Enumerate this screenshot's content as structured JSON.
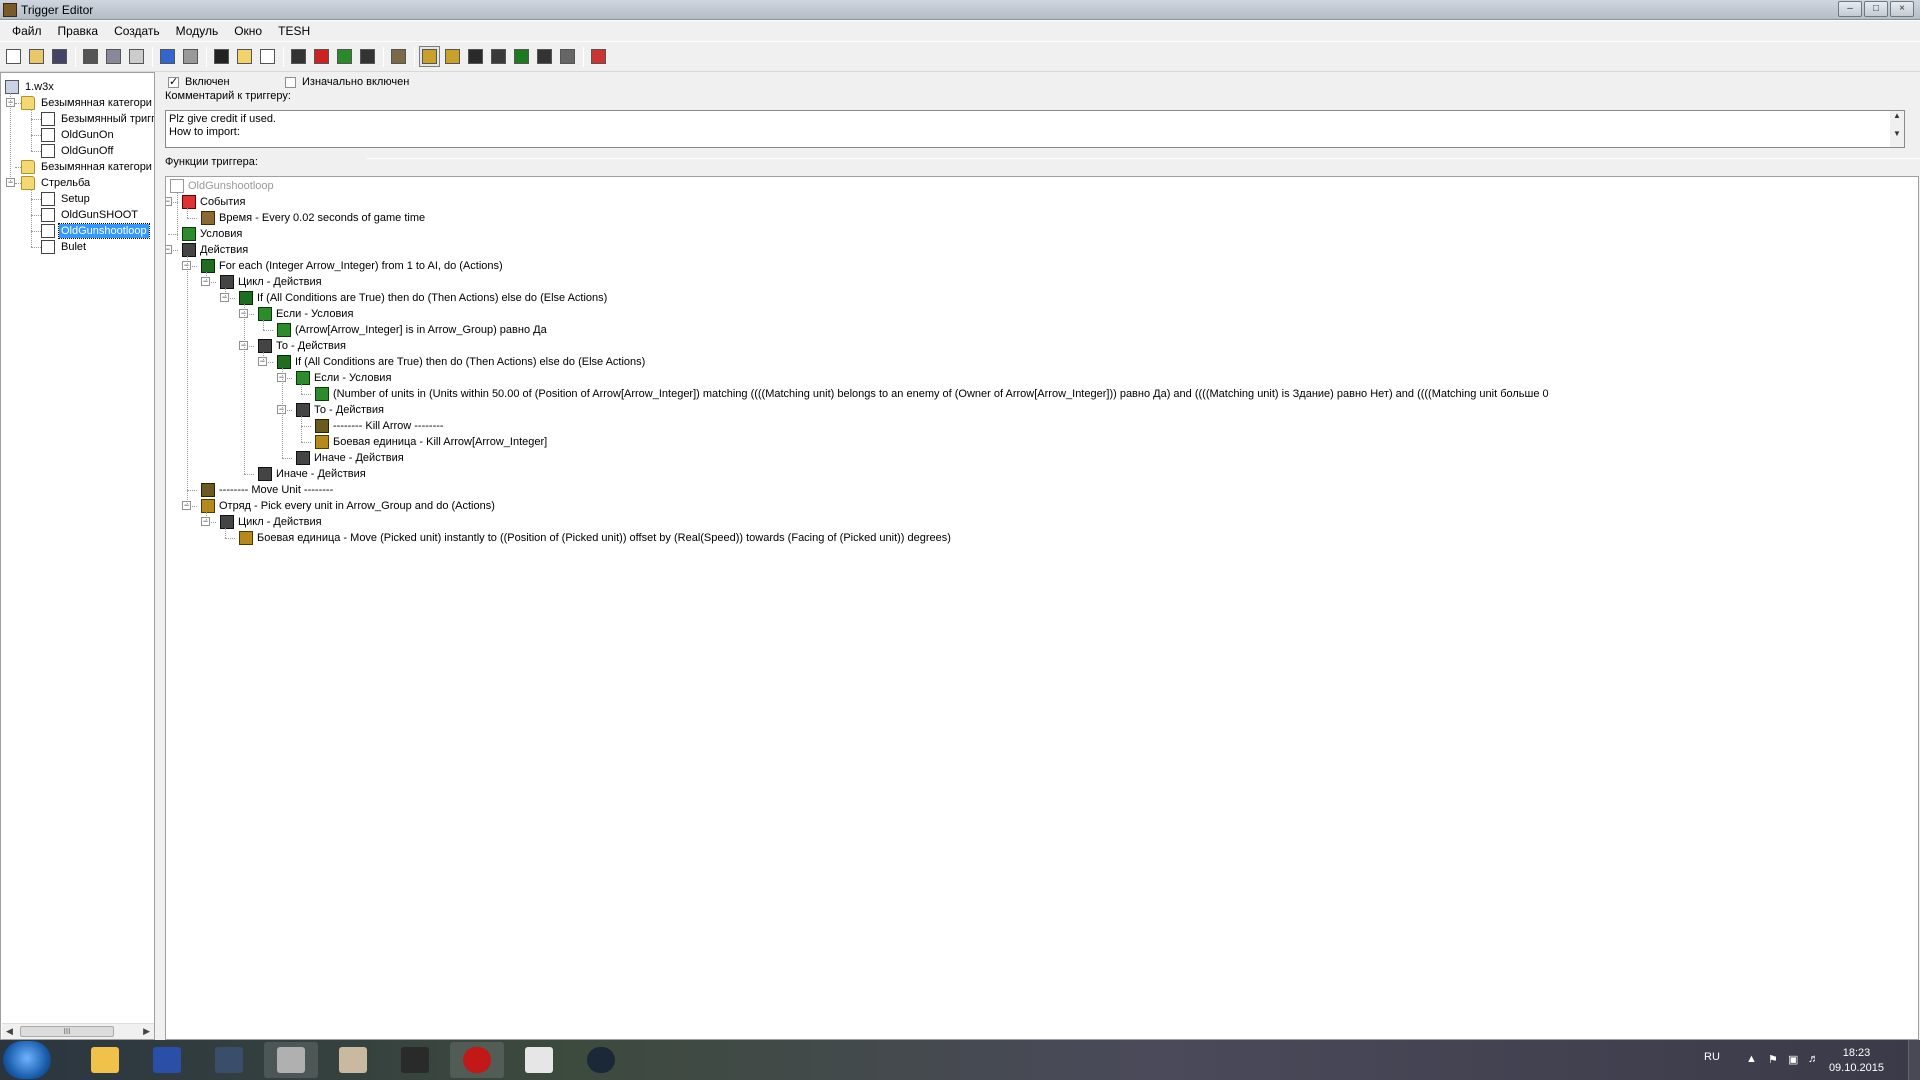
{
  "window": {
    "title": "Trigger Editor"
  },
  "menu": [
    "Файл",
    "Правка",
    "Создать",
    "Модуль",
    "Окно",
    "TESH"
  ],
  "toolbar": {
    "icons": [
      "new-icon",
      "open-icon",
      "save-icon",
      "cut-icon",
      "copy-icon",
      "paste-icon",
      "undo-icon",
      "redo-icon",
      "delete-icon",
      "new-category-icon",
      "new-trigger-icon",
      "new-comment-icon",
      "new-event-icon",
      "new-condition-icon",
      "new-action-icon",
      "terrain-editor-icon",
      "trigger-editor-icon",
      "sound-editor-icon",
      "object-editor-icon",
      "campaign-editor-icon",
      "ai-editor-icon",
      "object-manager-icon",
      "import-manager-icon",
      "test-map-icon"
    ],
    "active_index": 16
  },
  "left_tree": {
    "root": "1.w3x",
    "items": [
      {
        "label": "Безымянная категори",
        "type": "folder",
        "level": 0,
        "expanded": true
      },
      {
        "label": "Безымянный тригг",
        "type": "trigger",
        "level": 1
      },
      {
        "label": "OldGunOn",
        "type": "trigger",
        "level": 1
      },
      {
        "label": "OldGunOff",
        "type": "trigger",
        "level": 1
      },
      {
        "label": "Безымянная категори",
        "type": "folder",
        "level": 0,
        "expanded": false
      },
      {
        "label": "Стрельба",
        "type": "folder",
        "level": 0,
        "expanded": true
      },
      {
        "label": "Setup",
        "type": "trigger",
        "level": 1
      },
      {
        "label": "OldGunSHOOT",
        "type": "trigger",
        "level": 1
      },
      {
        "label": "OldGunshootloop",
        "type": "trigger",
        "level": 1,
        "selected": true
      },
      {
        "label": "Bulet",
        "type": "trigger",
        "level": 1
      }
    ],
    "scroll_thumb": "III"
  },
  "trigger": {
    "enabled_label": "Включен",
    "enabled": true,
    "initially_on_label": "Изначально включен",
    "initially_on": false,
    "comment_label": "Комментарий к триггеру:",
    "comment_lines": [
      "Plz give credit if used.",
      "How to import:"
    ],
    "functions_label": "Функции триггера:"
  },
  "function_tree": [
    {
      "text": "OldGunshootloop",
      "icon": "trigger-doc-icon",
      "depth": 0,
      "gray": true
    },
    {
      "text": "События",
      "icon": "events-flag-icon",
      "depth": 0,
      "box": "-"
    },
    {
      "text": "Время - Every 0.02 seconds of game time",
      "icon": "time-icon",
      "depth": 1
    },
    {
      "text": "Условия",
      "icon": "conditions-icon",
      "depth": 0
    },
    {
      "text": "Действия",
      "icon": "actions-icon",
      "depth": 0,
      "box": "-"
    },
    {
      "text": "For each (Integer Arrow_Integer) from 1 to AI, do (Actions)",
      "icon": "loop-icon",
      "depth": 1,
      "box": "-"
    },
    {
      "text": "Цикл - Действия",
      "icon": "actions-icon",
      "depth": 2,
      "box": "-"
    },
    {
      "text": "If (All Conditions are True) then do (Then Actions) else do (Else Actions)",
      "icon": "if-icon",
      "depth": 3,
      "box": "-"
    },
    {
      "text": "Если - Условия",
      "icon": "conditions-icon",
      "depth": 4,
      "box": "-"
    },
    {
      "text": "(Arrow[Arrow_Integer] is in Arrow_Group) равно Да",
      "icon": "condition-icon",
      "depth": 5
    },
    {
      "text": "То - Действия",
      "icon": "actions-icon",
      "depth": 4,
      "box": "-"
    },
    {
      "text": "If (All Conditions are True) then do (Then Actions) else do (Else Actions)",
      "icon": "if-icon",
      "depth": 5,
      "box": "-"
    },
    {
      "text": "Если - Условия",
      "icon": "conditions-icon",
      "depth": 6,
      "box": "-"
    },
    {
      "text": "(Number of units in (Units within 50.00 of (Position of Arrow[Arrow_Integer]) matching ((((Matching unit) belongs to an enemy of (Owner of Arrow[Arrow_Integer])) равно Да) and ((((Matching unit) is Здание) равно Нет) and ((((Matching unit больше 0",
      "icon": "condition-icon",
      "depth": 7
    },
    {
      "text": "То - Действия",
      "icon": "actions-icon",
      "depth": 6,
      "box": "-"
    },
    {
      "text": "-------- Kill Arrow --------",
      "icon": "comment-icon",
      "depth": 7
    },
    {
      "text": "Боевая единица - Kill Arrow[Arrow_Integer]",
      "icon": "unit-icon",
      "depth": 7
    },
    {
      "text": "Иначе - Действия",
      "icon": "actions-icon",
      "depth": 6
    },
    {
      "text": "Иначе - Действия",
      "icon": "actions-icon",
      "depth": 4
    },
    {
      "text": "-------- Move Unit --------",
      "icon": "comment-icon",
      "depth": 1
    },
    {
      "text": "Отряд - Pick every unit in Arrow_Group and do (Actions)",
      "icon": "group-icon",
      "depth": 1,
      "box": "-"
    },
    {
      "text": "Цикл - Действия",
      "icon": "actions-icon",
      "depth": 2,
      "box": "-"
    },
    {
      "text": "Боевая единица - Move (Picked unit) instantly to ((Position of (Picked unit)) offset by (Real(Speed)) towards (Facing of (Picked unit)) degrees)",
      "icon": "unit-icon",
      "depth": 3
    }
  ],
  "taskbar": {
    "apps": [
      "explorer-icon",
      "save-disk-icon",
      "window-icon",
      "blank-window-icon",
      "paint-icon",
      "warcraft-icon",
      "opera-icon",
      "app-window-icon",
      "steam-icon"
    ],
    "language": "RU",
    "time": "18:23",
    "date": "09.10.2015"
  },
  "colors": {
    "selection": "#3399ff",
    "chrome": "#f0f0f0"
  }
}
